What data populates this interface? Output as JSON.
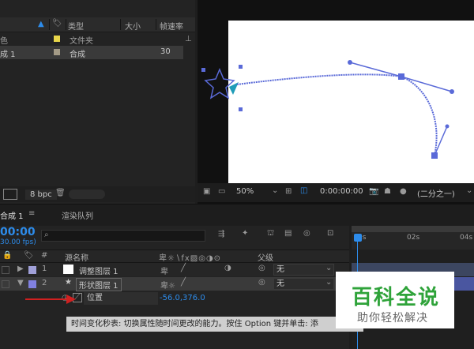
{
  "project": {
    "columns": {
      "type": "类型",
      "size": "大小",
      "framerate": "帧速率"
    },
    "rows": [
      {
        "name": "色",
        "swatch": "#e8d64a",
        "type": "文件夹",
        "size": "",
        "framerate": ""
      },
      {
        "name": "成 1",
        "swatch": "#a39a86",
        "type": "合成",
        "size": "",
        "framerate": "30"
      }
    ],
    "bpc": "8 bpc"
  },
  "viewer": {
    "zoom": "50%",
    "timecode": "0:00:00:00",
    "resolution": "(二分之一)"
  },
  "timeline": {
    "tab_comp": "合成 1",
    "tab_render": "渲染队列",
    "timecode": "00:00",
    "fps": "30.00 fps)",
    "search_placeholder": "",
    "col_hash": "#",
    "col_source": "源名称",
    "col_parent": "父级",
    "layers": [
      {
        "num": "1",
        "name": "调整图层 1",
        "parent": "无",
        "thumb": "#ffffff",
        "label": "#a0a0d8"
      },
      {
        "num": "2",
        "name": "形状图层 1",
        "parent": "无",
        "thumb": "",
        "label": "#8080e0"
      }
    ],
    "property": {
      "name": "位置",
      "value": "-56.0,376.0"
    },
    "ruler": [
      "0s",
      "02s",
      "04s"
    ],
    "tooltip": "时间变化秒表: 切换属性随时间更改的能力。按住 Option 键并单击: 添"
  },
  "watermark": {
    "title": "百科全说",
    "subtitle": "助你轻松解决"
  },
  "colors": {
    "accent": "#2d8ceb",
    "path": "#5a6ad8",
    "arrow": "#d02020"
  }
}
